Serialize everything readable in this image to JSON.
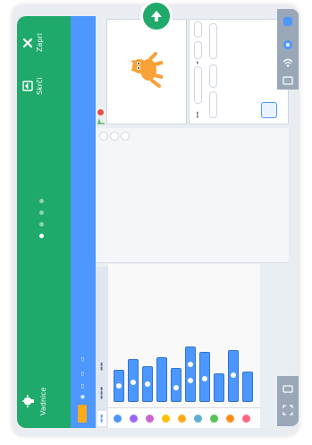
{
  "tutorial_bar": {
    "close_label": "Zapri",
    "videos_label": "Skrči",
    "tutorials_label": "Vadnice",
    "dots_total": 4,
    "active_dot": 1
  },
  "colors": {
    "tutorial_green": "#1faa6c",
    "menu_blue": "#4d97ff",
    "logo_orange": "#ffab19"
  },
  "icons": {
    "close": "close-icon",
    "shrink": "shrink-icon",
    "tutorials": "lightbulb-icon",
    "up": "arrow-up-icon",
    "cat": "cat-sprite-icon"
  }
}
